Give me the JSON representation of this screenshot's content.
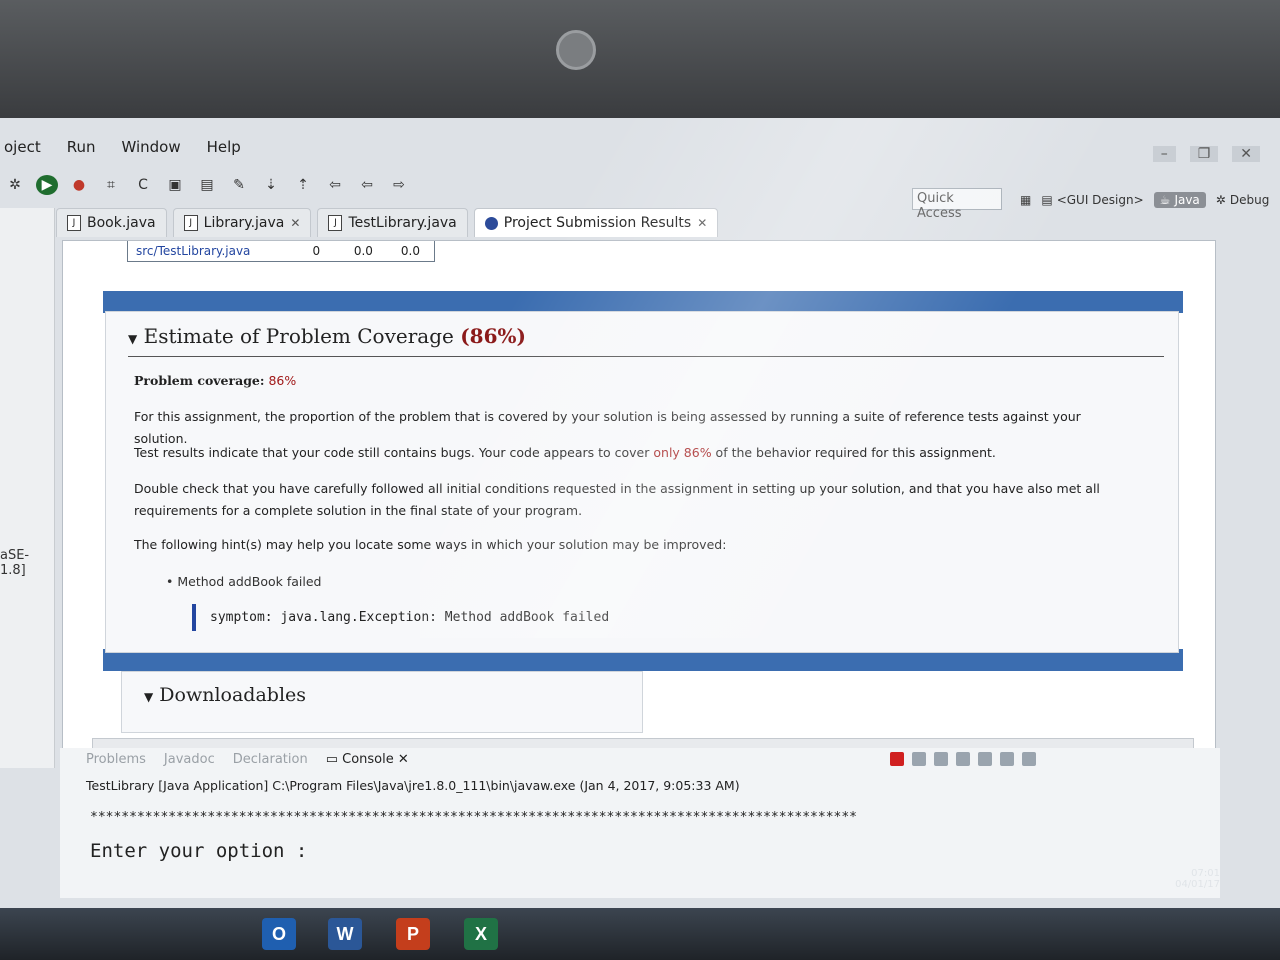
{
  "menu": [
    "oject",
    "Run",
    "Window",
    "Help"
  ],
  "quick_access": "Quick Access",
  "perspectives": {
    "gui": "<GUI Design>",
    "java": "Java",
    "debug": "Debug"
  },
  "tabs": [
    {
      "label": "Book.java",
      "closable": false
    },
    {
      "label": "Library.java",
      "closable": true
    },
    {
      "label": "TestLibrary.java",
      "closable": false
    },
    {
      "label": "Project Submission Results",
      "closable": true
    }
  ],
  "left_panel_label": "aSE-1.8]",
  "top_table": {
    "file": "src/TestLibrary.java",
    "col1": "0",
    "col2": "0.0",
    "col3": "0.0"
  },
  "coverage": {
    "title": "Estimate of Problem Coverage",
    "title_pct": "(86%)",
    "coverage_label": "Problem coverage:",
    "coverage_value": "86%",
    "p1": "For this assignment, the proportion of the problem that is covered by your solution is being assessed by running a suite of reference tests against your solution.",
    "p2_a": "Test results indicate that your code still contains bugs. Your code appears to cover ",
    "p2_b": "only 86%",
    "p2_c": " of the behavior required for this assignment.",
    "p3": "Double check that you have carefully followed all initial conditions requested in the assignment in setting up your solution, and that you have also met all requirements for a complete solution in the final state of your program.",
    "p4": "The following hint(s) may help you locate some ways in which your solution may be improved:",
    "hint": "Method addBook failed",
    "symptom": "symptom: java.lang.Exception: Method addBook failed"
  },
  "downloads_title": "Downloadables",
  "console": {
    "tabs": [
      "Problems",
      "Javadoc",
      "Declaration",
      "Console"
    ],
    "header": "TestLibrary [Java Application] C:\\Program Files\\Java\\jre1.8.0_111\\bin\\javaw.exe (Jan 4, 2017, 9:05:33 AM)",
    "stars": "**************************************************************************************************",
    "prompt": "Enter your option :"
  },
  "taskbar": {
    "apps": [
      "O",
      "W",
      "P",
      "X"
    ],
    "time": "07:01",
    "date": "04/01/17"
  },
  "colors": {
    "accent_blue": "#3b6db0",
    "emphasis_red": "#a01818"
  }
}
